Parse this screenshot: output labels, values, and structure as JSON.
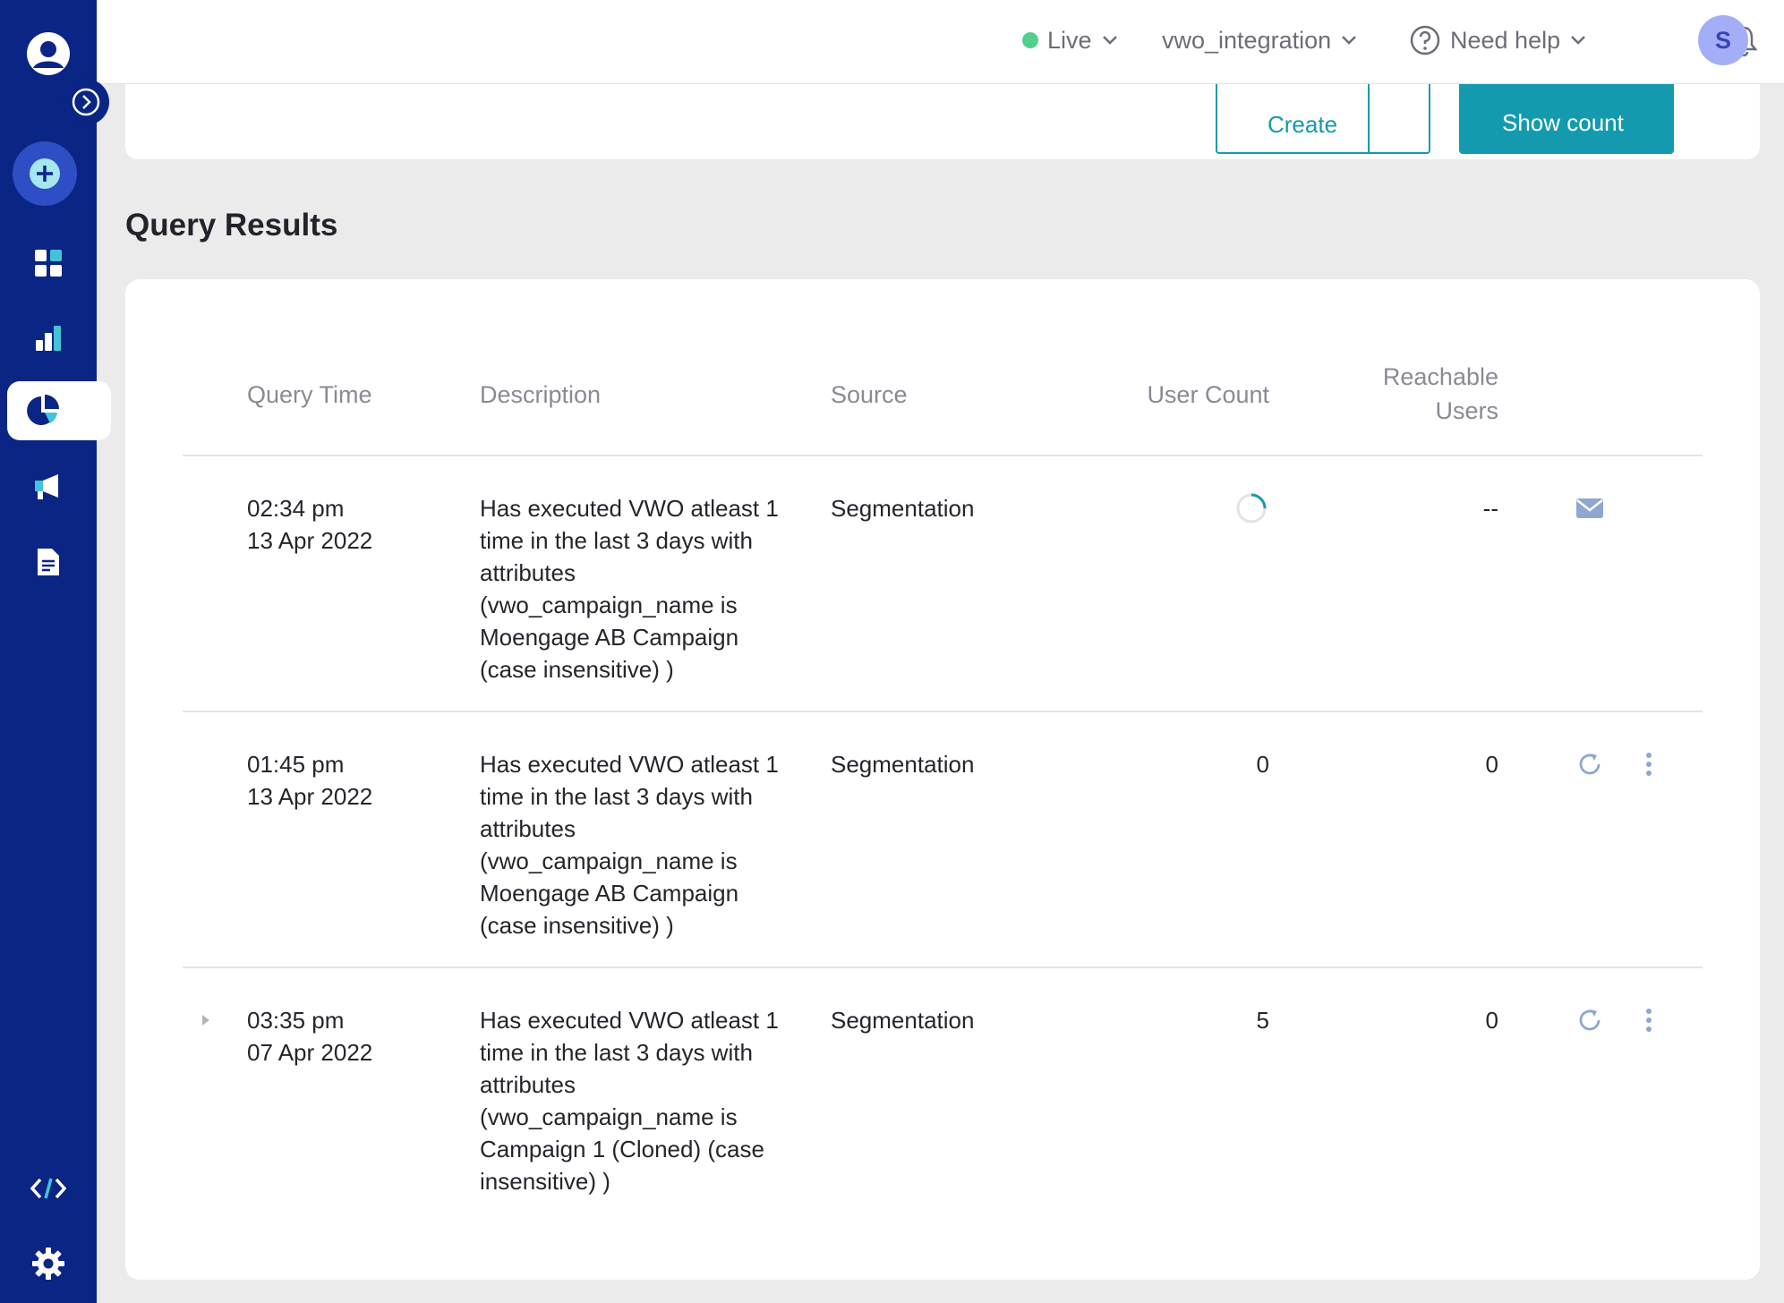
{
  "topbar": {
    "environment": "Live",
    "workspace": "vwo_integration",
    "help": "Need help",
    "avatar_initial": "S",
    "live_color": "#52d08b"
  },
  "top_card": {
    "create_label": "Create",
    "show_count_label": "Show count"
  },
  "sidebar": {
    "items": [
      {
        "icon": "user-icon"
      },
      {
        "icon": "expand-icon"
      },
      {
        "icon": "add-icon"
      },
      {
        "icon": "dashboard-icon"
      },
      {
        "icon": "analytics-icon"
      },
      {
        "icon": "segment-icon",
        "active": true
      },
      {
        "icon": "campaign-icon"
      },
      {
        "icon": "content-icon"
      },
      {
        "icon": "developer-icon"
      },
      {
        "icon": "settings-icon"
      }
    ]
  },
  "results": {
    "title": "Query Results",
    "columns": {
      "query_time": "Query Time",
      "description": "Description",
      "source": "Source",
      "user_count": "User Count",
      "reachable_line1": "Reachable",
      "reachable_line2": "Users"
    },
    "rows": [
      {
        "time": "02:34 pm",
        "date": "13 Apr 2022",
        "description": "Has executed VWO atleast 1 time in the last 3 days with attributes (vwo_campaign_name is Moengage AB Campaign (case insensitive) )",
        "source": "Segmentation",
        "user_count": "",
        "reachable": "--",
        "status": "loading"
      },
      {
        "time": "01:45 pm",
        "date": "13 Apr 2022",
        "description": "Has executed VWO atleast 1 time in the last 3 days with attributes (vwo_campaign_name is Moengage AB Campaign (case insensitive) )",
        "source": "Segmentation",
        "user_count": "0",
        "reachable": "0",
        "status": "done"
      },
      {
        "time": "03:35 pm",
        "date": "07 Apr 2022",
        "description": "Has executed VWO atleast 1 time in the last 3 days with attributes (vwo_campaign_name is Campaign 1 (Cloned) (case insensitive) )",
        "source": "Segmentation",
        "user_count": "5",
        "reachable": "0",
        "status": "done"
      }
    ]
  },
  "colors": {
    "sidebar": "#0b2585",
    "accent": "#149aae",
    "avatar": "#a3aef7"
  }
}
